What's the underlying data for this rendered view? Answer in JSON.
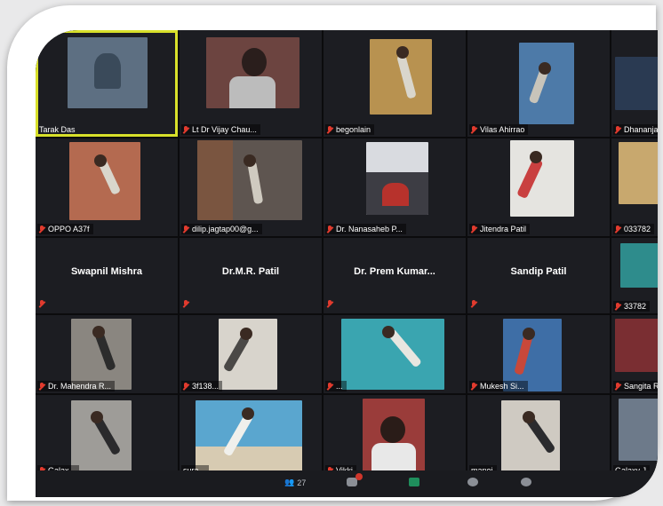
{
  "participants": {
    "row1": [
      {
        "name": "Tarak Das"
      },
      {
        "name": "Lt Dr Vijay Chau..."
      },
      {
        "name": "begonlain"
      },
      {
        "name": "Vilas Ahirrao"
      },
      {
        "name": "Dhananjay"
      }
    ],
    "row2": [
      {
        "name": "OPPO A37f"
      },
      {
        "name": "dilip.jagtap00@g..."
      },
      {
        "name": "Dr. Nanasaheb P..."
      },
      {
        "name": "Jitendra Patil"
      },
      {
        "name": "033782"
      }
    ],
    "row3": [
      {
        "name": "Swapnil Mishra"
      },
      {
        "name": "Dr.M.R. Patil"
      },
      {
        "name": "Dr. Prem Kumar..."
      },
      {
        "name": "Sandip Patil"
      },
      {
        "name": "33782"
      }
    ],
    "row4": [
      {
        "name": "Dr. Mahendra R..."
      },
      {
        "name": "3f138..."
      },
      {
        "name": "..."
      },
      {
        "name": "Mukesh Si..."
      },
      {
        "name": "Sangita Rrepar..."
      }
    ],
    "row5": [
      {
        "name": "Galax..."
      },
      {
        "name": "sura..."
      },
      {
        "name": "Vikki"
      },
      {
        "name": "manoj"
      },
      {
        "name": "Galaxy J"
      }
    ]
  },
  "toolbar": {
    "participants_count": "27"
  },
  "colors": {
    "active_speaker_border": "#d8e02a",
    "muted_icon": "#e23b2e"
  }
}
